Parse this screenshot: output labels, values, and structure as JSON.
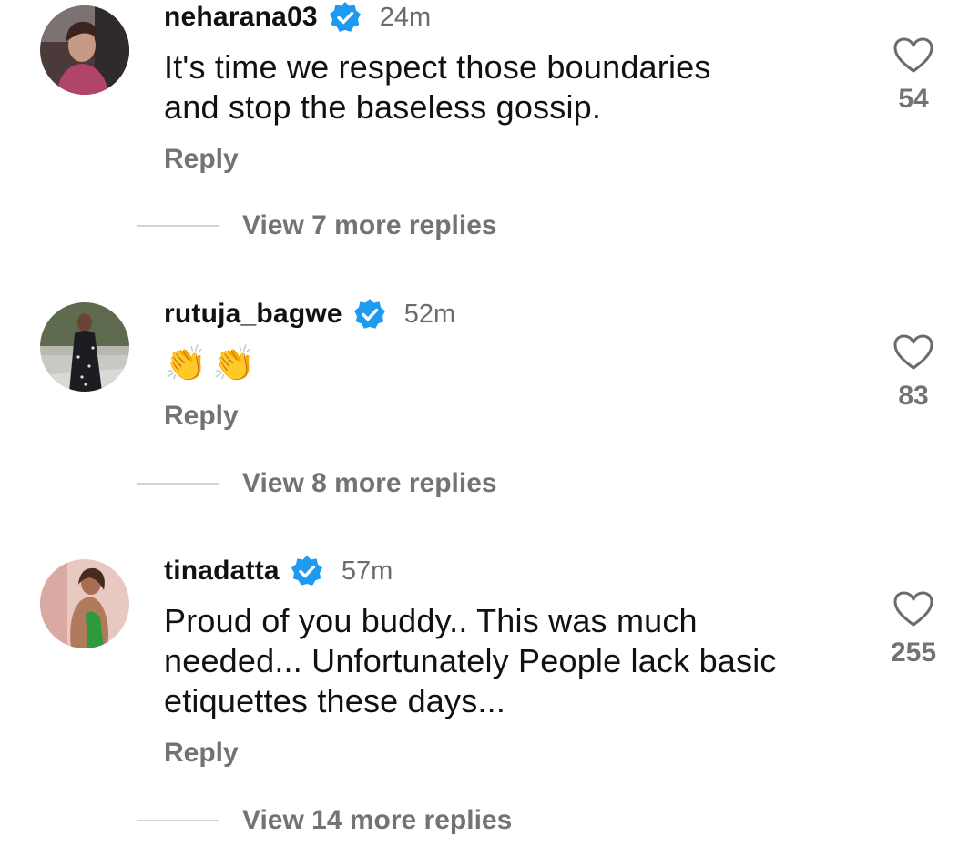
{
  "comments": [
    {
      "username": "neharana03",
      "verified": true,
      "time": "24m",
      "text": "It's time we respect those boundaries\nand stop the baseless gossip.",
      "reply_label": "Reply",
      "view_more": "View 7 more replies",
      "likes": "54"
    },
    {
      "username": "rutuja_bagwe",
      "verified": true,
      "time": "52m",
      "text": "👏👏",
      "reply_label": "Reply",
      "view_more": "View 8 more replies",
      "likes": "83"
    },
    {
      "username": "tinadatta",
      "verified": true,
      "time": "57m",
      "text": "Proud of you buddy.. This was much\nneeded... Unfortunately People lack basic\netiquettes these days...",
      "reply_label": "Reply",
      "view_more": "View 14 more replies",
      "likes": "255"
    }
  ],
  "colors": {
    "verified_badge": "#1d9bf0",
    "secondary_text": "#737373",
    "primary_text": "#111111"
  },
  "icons": {
    "verified": "verified-badge-icon",
    "like": "heart-outline-icon"
  }
}
